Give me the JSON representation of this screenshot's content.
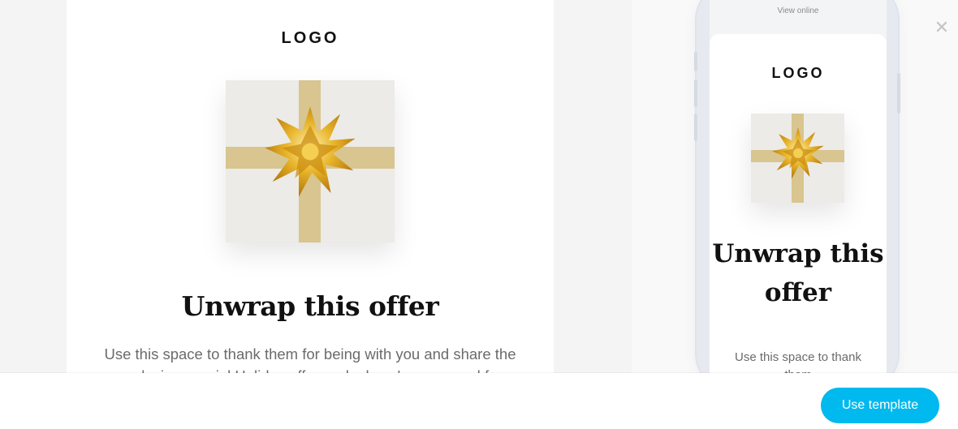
{
  "desktop_preview": {
    "logo": "LOGO",
    "headline": "Unwrap this offer",
    "body": "Use this space to thank them for being with you and share the exclusive special Holiday offer or deal you've prepared for them."
  },
  "mobile_preview": {
    "view_online": "View online",
    "logo": "LOGO",
    "headline": "Unwrap this offer",
    "body": "Use this space to thank them"
  },
  "footer": {
    "use_template_label": "Use template"
  },
  "close": {
    "icon": "close-icon",
    "glyph": "✕"
  },
  "colors": {
    "accent": "#00b9ee",
    "ribbon": "#d8c58f",
    "bow": "#d9a21a"
  }
}
